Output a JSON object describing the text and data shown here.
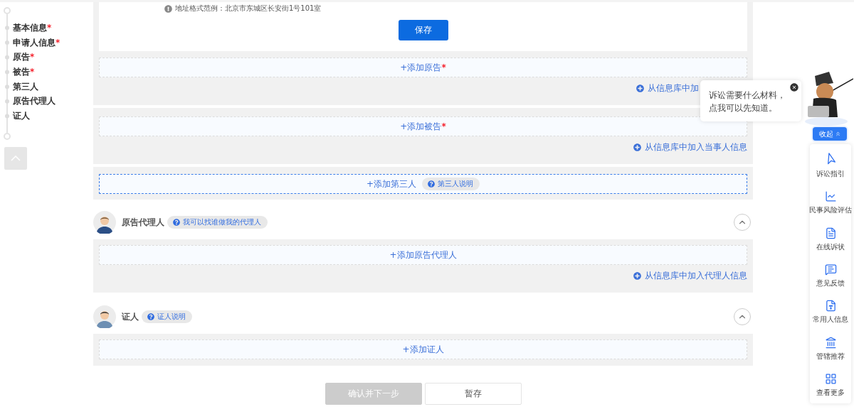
{
  "nav": {
    "items": [
      {
        "label": "基本信息",
        "mark": "*"
      },
      {
        "label": "申请人信息",
        "mark": "*"
      },
      {
        "label": "原告",
        "mark": "*"
      },
      {
        "label": "被告",
        "mark": "*"
      },
      {
        "label": "第三人"
      },
      {
        "label": "原告代理人"
      },
      {
        "label": "证人"
      }
    ]
  },
  "address_hint": "地址格式范例：北京市东城区长安街1号101室",
  "save_button": "保存",
  "party_sections": [
    {
      "add_label": "+添加原告",
      "mark": "*",
      "highlighted": false,
      "library_link": "从信息库中加"
    },
    {
      "add_label": "+添加被告",
      "mark": "*",
      "highlighted": false,
      "library_link": "从信息库中加入当事人信息"
    },
    {
      "add_label": "+添加第三人",
      "highlighted": true,
      "help_badge": "第三人说明"
    }
  ],
  "groups": [
    {
      "title": "原告代理人",
      "help_badge": "我可以找谁做我的代理人",
      "expanded": true,
      "add_label": "+添加原告代理人",
      "library_link": "从信息库中加入代理人信息"
    },
    {
      "title": "证人",
      "help_badge": "证人说明",
      "expanded": true,
      "add_label": "+添加证人"
    }
  ],
  "footer": {
    "buttons": [
      {
        "label": "确认并下一步",
        "disabled": true
      },
      {
        "label": "暂存",
        "disabled": false
      }
    ]
  },
  "assistant": {
    "message": "诉讼需要什么材料，点我可以先知道。",
    "collapse_button": "收起"
  },
  "side_tools": [
    {
      "label": "诉讼指引"
    },
    {
      "label": "民事风险评估"
    },
    {
      "label": "在线诉状"
    },
    {
      "label": "意见反馈"
    },
    {
      "label": "常用人信息"
    },
    {
      "label": "管辖推荐"
    },
    {
      "label": "查看更多"
    }
  ]
}
